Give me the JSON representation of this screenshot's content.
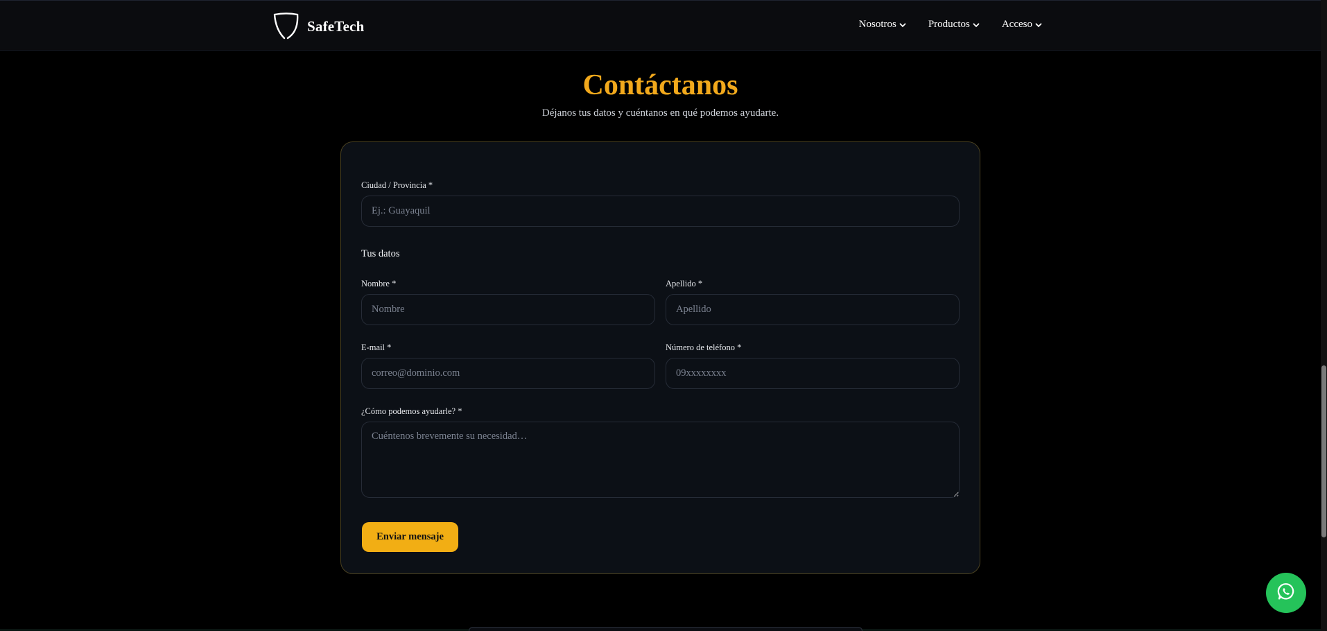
{
  "header": {
    "brand": "SafeTech",
    "nav": [
      {
        "label": "Nosotros"
      },
      {
        "label": "Productos"
      },
      {
        "label": "Acceso"
      }
    ]
  },
  "contact": {
    "title": "Contáctanos",
    "subtitle": "Déjanos tus datos y cuéntanos en qué podemos ayudarte."
  },
  "form": {
    "city": {
      "label": "Ciudad / Provincia *",
      "placeholder": "Ej.: Guayaquil",
      "value": ""
    },
    "section_title": "Tus datos",
    "first_name": {
      "label": "Nombre *",
      "placeholder": "Nombre",
      "value": ""
    },
    "last_name": {
      "label": "Apellido *",
      "placeholder": "Apellido",
      "value": ""
    },
    "email": {
      "label": "E-mail *",
      "placeholder": "correo@dominio.com",
      "value": ""
    },
    "phone": {
      "label": "Número de teléfono *",
      "placeholder": "09xxxxxxxx",
      "value": ""
    },
    "message": {
      "label": "¿Cómo podemos ayudarle? *",
      "placeholder": "Cuéntenos brevemente su necesidad…",
      "value": ""
    },
    "submit_label": "Enviar mensaje"
  },
  "colors": {
    "accent": "#f2a91c",
    "button": "#f2ae14",
    "whatsapp": "#25c35a",
    "background": "#000000",
    "card": "#0c1016"
  },
  "icons": {
    "brand": "shield-logo-icon",
    "nav_chevron": "chevron-down-icon",
    "floating": "whatsapp-icon"
  }
}
